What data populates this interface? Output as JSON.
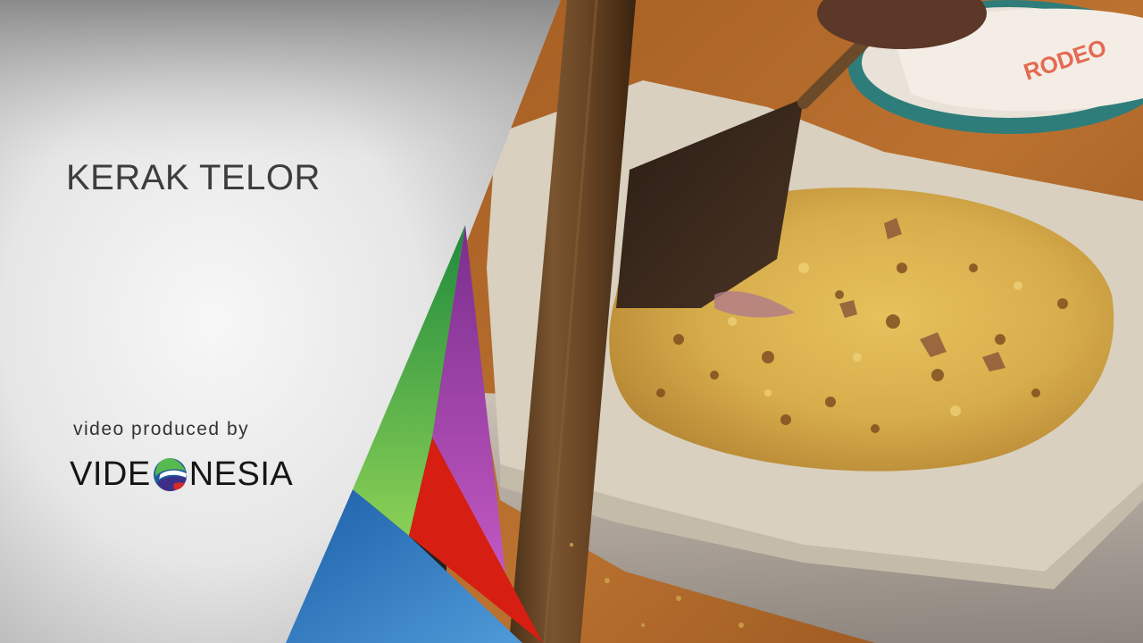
{
  "overlay": {
    "title": "KERAK TELOR",
    "credit_line": "video produced by",
    "logo": {
      "text_before": "VIDE",
      "text_after": "NESIA"
    }
  },
  "colors": {
    "title_text": "#3d3d3f",
    "stripe_green": "#45b443",
    "stripe_purple": "#9a3ea8",
    "stripe_red": "#d61e12",
    "stripe_blue": "#3f87cd",
    "paper": "#d9d0bf",
    "table_wood": "#b36a2a",
    "omelette": "#dcb450"
  }
}
